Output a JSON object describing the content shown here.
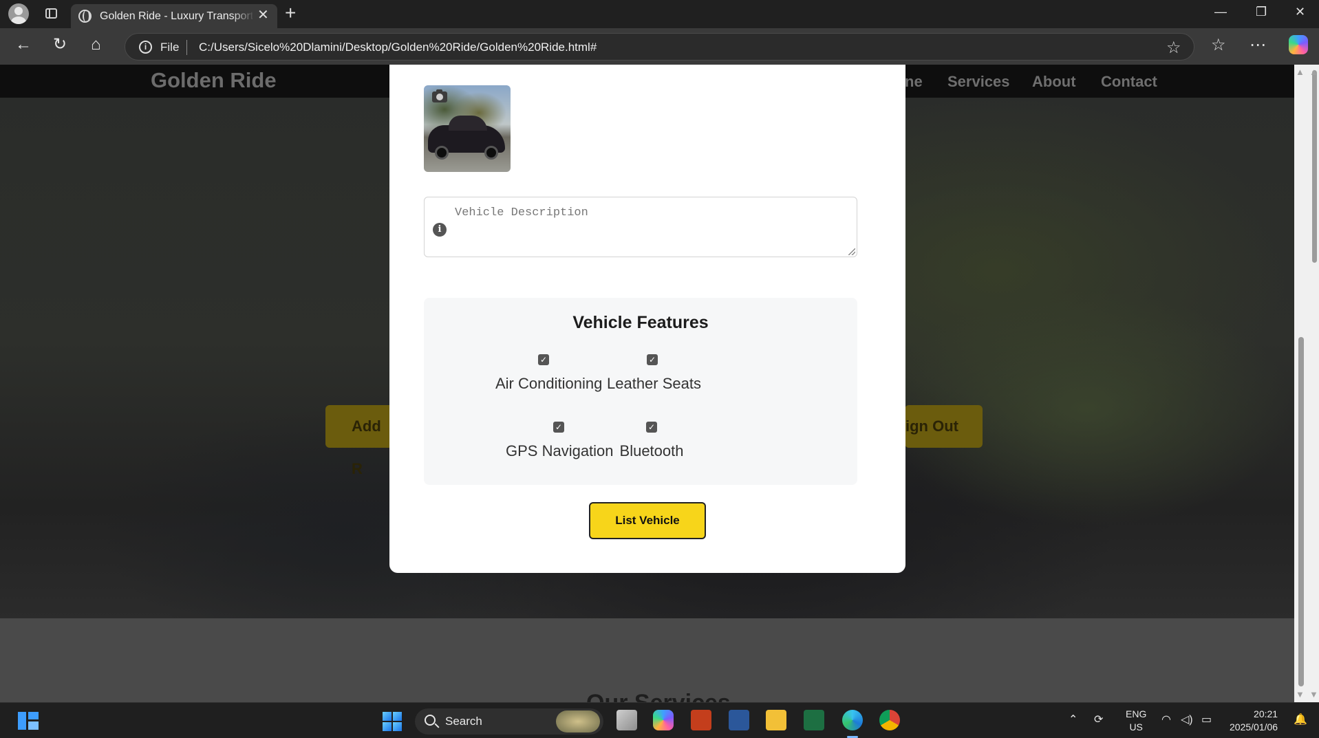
{
  "browser": {
    "tab_title": "Golden Ride - Luxury Transportati",
    "file_label": "File",
    "url": "C:/Users/Sicelo%20Dlamini/Desktop/Golden%20Ride/Golden%20Ride.html#"
  },
  "site": {
    "logo": "Golden Ride",
    "nav": [
      "ne",
      "Services",
      "About",
      "Contact"
    ],
    "hero_buttons": {
      "left": "Add R",
      "right": "ign Out"
    },
    "services_heading": "Our Services"
  },
  "modal": {
    "description_placeholder": "Vehicle Description",
    "features_title": "Vehicle Features",
    "features": [
      {
        "label": "Air Conditioning",
        "checked": true
      },
      {
        "label": "Leather Seats",
        "checked": true
      },
      {
        "label": "GPS Navigation",
        "checked": true
      },
      {
        "label": "Bluetooth",
        "checked": true
      }
    ],
    "submit_label": "List Vehicle"
  },
  "taskbar": {
    "search_label": "Search",
    "language": "ENG",
    "region": "US",
    "time": "20:21",
    "date": "2025/01/06"
  },
  "colors": {
    "accent_yellow": "#f7d51a",
    "page_bg": "#202020"
  }
}
